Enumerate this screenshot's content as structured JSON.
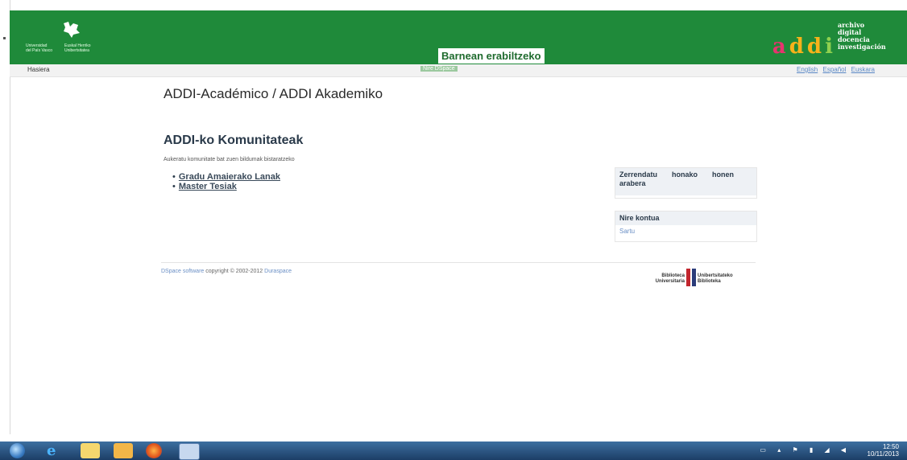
{
  "header": {
    "logo_left_line1": "Universidad",
    "logo_left_line2": "del País Vasco",
    "logo_right_line1": "Euskal Herriko",
    "logo_right_line2": "Unibertsitatea",
    "intranet_label": "Barnean erabiltzeko",
    "brand_letters": [
      "a",
      "d",
      "d",
      "i"
    ],
    "brand_tagline": [
      "archivo",
      "digital",
      "docencia",
      "investigación"
    ]
  },
  "nav": {
    "home": "Hasiera",
    "center": "Nire DSpace",
    "languages": [
      "English",
      "Español",
      "Euskara"
    ]
  },
  "main": {
    "page_title": "ADDI-Académico / ADDI Akademiko",
    "section_title": "ADDI-ko Komunitateak",
    "section_desc": "Aukeratu komunitate bat zuen bildumak bistaratzeko",
    "communities": [
      "Gradu Amaierako Lanak",
      "Master Tesiak"
    ]
  },
  "sidebar": {
    "browse_title_words": [
      "Zerrendatu",
      "honako",
      "honen",
      "arabera"
    ],
    "account_title": "Nire kontua",
    "login_link": "Sartu"
  },
  "footer": {
    "software_link": "DSpace software",
    "copyright": "copyright © 2002-2012",
    "duraspace_link": "Duraspace",
    "library_left_line1": "Biblioteca",
    "library_left_line2": "Universitaria",
    "library_right_line1": "Unibertsitateko",
    "library_right_line2": "Biblioteka"
  },
  "taskbar": {
    "time": "12:50",
    "date": "10/11/2013"
  },
  "colors": {
    "header_green": "#1f8a3a",
    "link_blue": "#6a8fc5",
    "brand_pink": "#e8336f",
    "brand_yellow": "#f7b21a",
    "brand_lightgreen": "#8fd14f"
  }
}
